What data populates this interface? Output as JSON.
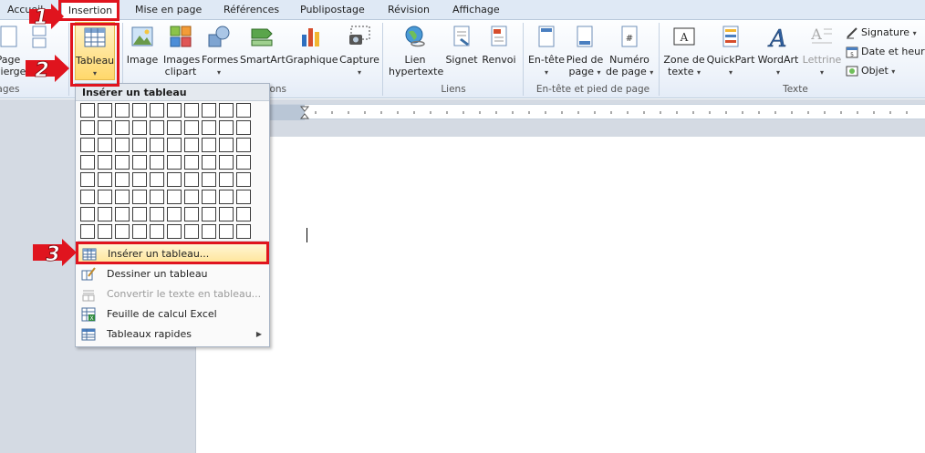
{
  "tabs": [
    {
      "label": "Accueil",
      "active": false
    },
    {
      "label": "Insertion",
      "active": true
    },
    {
      "label": "Mise en page",
      "active": false
    },
    {
      "label": "Références",
      "active": false
    },
    {
      "label": "Publipostage",
      "active": false
    },
    {
      "label": "Révision",
      "active": false
    },
    {
      "label": "Affichage",
      "active": false
    }
  ],
  "ribbon": {
    "pages": {
      "btn1_l1": "Page",
      "btn1_l2": "vierge",
      "group": "Pages"
    },
    "tableaux": {
      "label": "Tableau"
    },
    "illustrations": {
      "image": "Image",
      "clipart_l1": "Images",
      "clipart_l2": "clipart",
      "formes": "Formes",
      "smartart": "SmartArt",
      "graphique": "Graphique",
      "capture": "Capture",
      "group": "Illustrations"
    },
    "liens": {
      "lien_l1": "Lien",
      "lien_l2": "hypertexte",
      "signet": "Signet",
      "renvoi": "Renvoi",
      "group": "Liens"
    },
    "entete": {
      "entete": "En-tête",
      "pied_l1": "Pied de",
      "pied_l2": "page",
      "numero_l1": "Numéro",
      "numero_l2": "de page",
      "group": "En-tête et pied de page"
    },
    "texte": {
      "zone_l1": "Zone de",
      "zone_l2": "texte",
      "quickpart": "QuickPart",
      "wordart": "WordArt",
      "lettrine": "Lettrine",
      "signature": "Signature",
      "dateheure": "Date et heure",
      "objet": "Objet",
      "group": "Texte"
    }
  },
  "dropdown": {
    "header": "Insérer un tableau",
    "items": [
      {
        "label": "Insérer un tableau...",
        "disabled": false
      },
      {
        "label": "Dessiner un tableau",
        "disabled": false
      },
      {
        "label": "Convertir le texte en tableau...",
        "disabled": true
      },
      {
        "label": "Feuille de calcul Excel",
        "disabled": false
      },
      {
        "label": "Tableaux rapides",
        "disabled": false
      }
    ]
  },
  "steps": [
    "1",
    "2",
    "3"
  ],
  "colors": {
    "annotation_red": "#e0141e",
    "hover_gold": "#ffe59b",
    "ribbon_blue": "#dfe9f5"
  }
}
